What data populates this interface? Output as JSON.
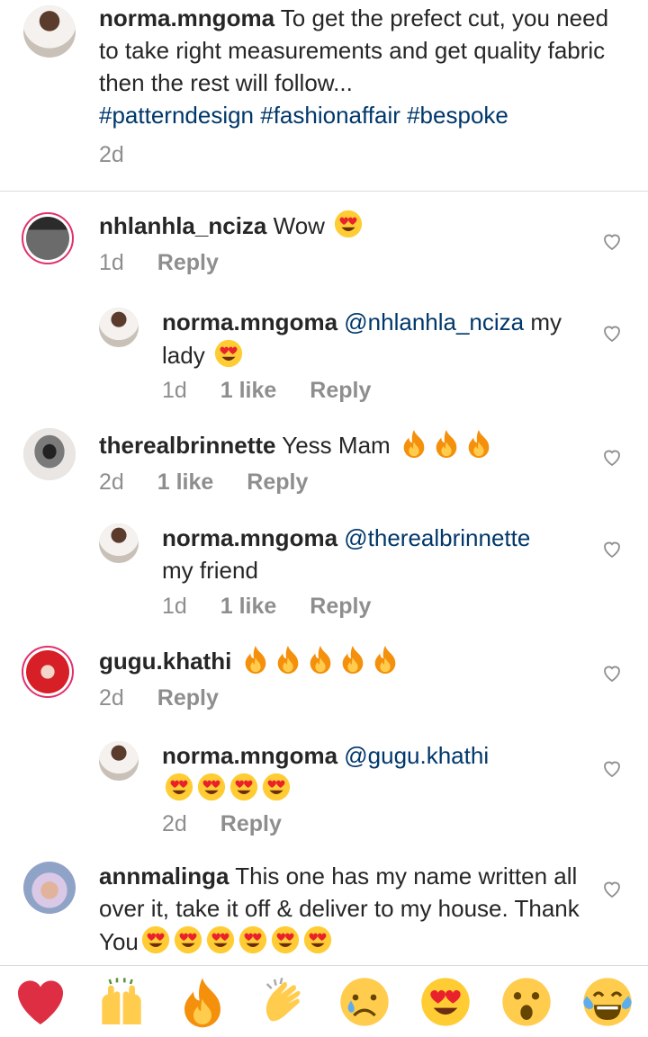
{
  "caption": {
    "username": "norma.mngoma",
    "text": "To get the prefect cut, you need to take right measurements and get quality fabric then the rest will follow",
    "ellipsis": "...",
    "hashtags": "#patterndesign #fashionaffair #bespoke",
    "time": "2d"
  },
  "comments": [
    {
      "username": "nhlanhla_nciza",
      "text": "Wow",
      "time": "1d",
      "reply_label": "Reply"
    },
    {
      "username": "norma.mngoma",
      "mention": "@nhlanhla_nciza",
      "text": "my lady",
      "time": "1d",
      "likes": "1 like",
      "reply_label": "Reply"
    },
    {
      "username": "therealbrinnette",
      "text": "Yess Mam",
      "time": "2d",
      "likes": "1 like",
      "reply_label": "Reply"
    },
    {
      "username": "norma.mngoma",
      "mention": "@therealbrinnette",
      "text": "my friend",
      "time": "1d",
      "likes": "1 like",
      "reply_label": "Reply"
    },
    {
      "username": "gugu.khathi",
      "text": "",
      "time": "2d",
      "reply_label": "Reply"
    },
    {
      "username": "norma.mngoma",
      "mention": "@gugu.khathi",
      "text": "",
      "time": "2d",
      "reply_label": "Reply"
    },
    {
      "username": "annmalinga",
      "text": "This one has my name written all over it, take it off & deliver to my house. Thank You"
    }
  ],
  "reactions": [
    "red-heart",
    "raising-hands",
    "fire",
    "clapping-hands",
    "sad-face",
    "heart-eyes",
    "surprised-face",
    "tears-of-joy"
  ],
  "colors": {
    "mention": "#00376b",
    "meta": "#8e8e8e",
    "ring": "#e1306c"
  }
}
